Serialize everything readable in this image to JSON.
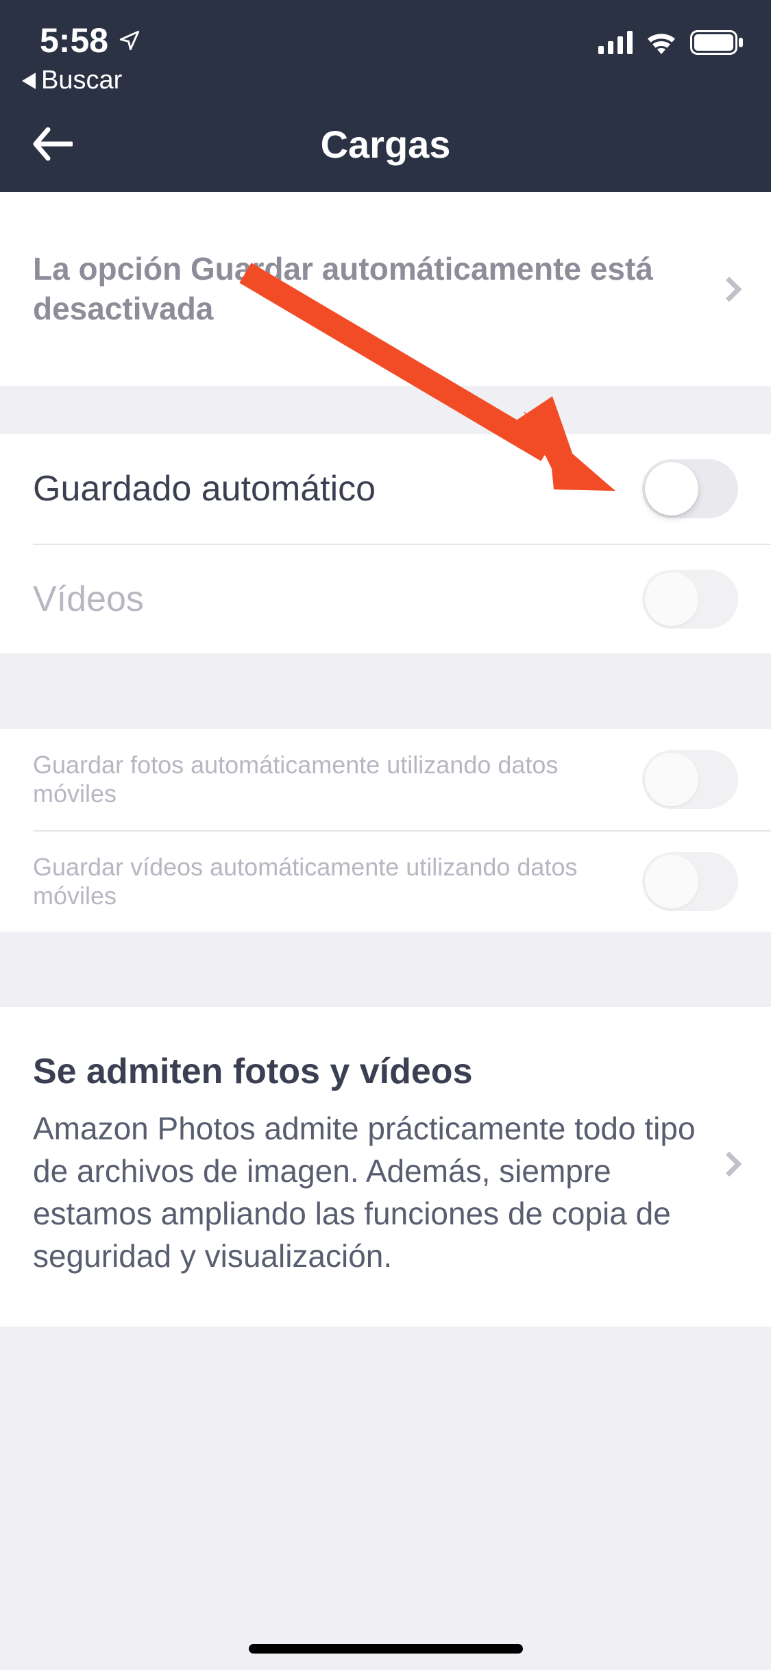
{
  "status_bar": {
    "time": "5:58",
    "back_label": "Buscar"
  },
  "nav": {
    "title": "Cargas"
  },
  "banner": {
    "text": "La opción Guardar automáticamente está desactivada"
  },
  "toggles": {
    "autosave": {
      "label": "Guardado automático",
      "on": false,
      "enabled": true
    },
    "videos": {
      "label": "Vídeos",
      "on": false,
      "enabled": false
    },
    "photos_cellular": {
      "label": "Guardar fotos automáticamente utilizando datos móviles",
      "on": false,
      "enabled": false
    },
    "videos_cellular": {
      "label": "Guardar vídeos automáticamente utilizando datos móviles",
      "on": false,
      "enabled": false
    }
  },
  "info": {
    "title": "Se admiten fotos y vídeos",
    "body": "Amazon Photos admite prácticamente todo tipo de archivos de imagen. Además, siempre estamos ampliando las funciones de copia de seguridad y visualización."
  },
  "colors": {
    "header_bg": "#2b3244",
    "annotation": "#f24c27"
  }
}
